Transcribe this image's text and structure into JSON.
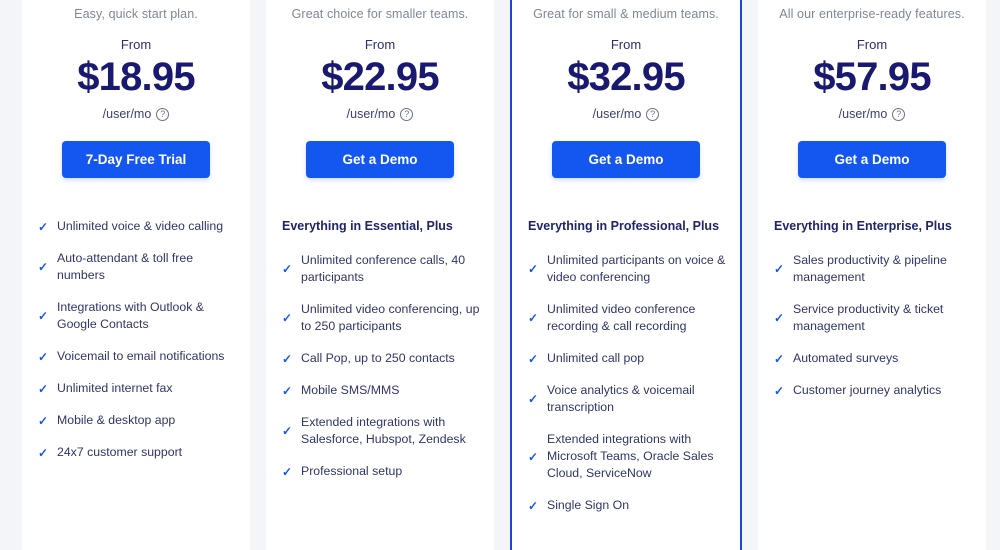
{
  "colors": {
    "accent": "#1456f0",
    "featured_border": "#1a44e0",
    "price": "#191970",
    "tagline": "#7e8798",
    "feature_text": "#2f3566",
    "page_background": "#f4f5f8",
    "card_background": "#ffffff"
  },
  "labels": {
    "from": "From",
    "per_user": "/user/mo",
    "info_icon": "question-mark-circle-icon",
    "info_glyph": "?",
    "check_glyph": "✓"
  },
  "plans": [
    {
      "tagline": "Easy, quick start plan.",
      "from_label": "From",
      "price": "$18.95",
      "per_user": "/user/mo",
      "cta_label": "7-Day Free Trial",
      "featured": false,
      "features_heading": "",
      "features": [
        "Unlimited voice & video calling",
        "Auto-attendant & toll free numbers",
        "Integrations with Outlook & Google Contacts",
        "Voicemail to email notifications",
        "Unlimited internet fax",
        "Mobile & desktop app",
        "24x7 customer support"
      ]
    },
    {
      "tagline": "Great choice for smaller teams.",
      "from_label": "From",
      "price": "$22.95",
      "per_user": "/user/mo",
      "cta_label": "Get a Demo",
      "featured": false,
      "features_heading": "Everything in Essential, Plus",
      "features": [
        "Unlimited conference calls, 40 participants",
        "Unlimited video conferencing, up to 250 participants",
        "Call Pop, up to 250 contacts",
        "Mobile SMS/MMS",
        "Extended integrations with Salesforce, Hubspot, Zendesk",
        "Professional setup"
      ]
    },
    {
      "tagline": "Great for small & medium teams.",
      "from_label": "From",
      "price": "$32.95",
      "per_user": "/user/mo",
      "cta_label": "Get a Demo",
      "featured": true,
      "features_heading": "Everything in Professional, Plus",
      "features": [
        "Unlimited participants on voice & video conferencing",
        "Unlimited video conference recording & call recording",
        "Unlimited call pop",
        "Voice analytics & voicemail transcription",
        "Extended integrations with Microsoft Teams, Oracle Sales Cloud, ServiceNow",
        "Single Sign On"
      ]
    },
    {
      "tagline": "All our enterprise-ready features.",
      "from_label": "From",
      "price": "$57.95",
      "per_user": "/user/mo",
      "cta_label": "Get a Demo",
      "featured": false,
      "features_heading": "Everything in Enterprise, Plus",
      "features": [
        "Sales productivity & pipeline management",
        "Service productivity & ticket management",
        "Automated surveys",
        "Customer journey analytics"
      ]
    }
  ]
}
